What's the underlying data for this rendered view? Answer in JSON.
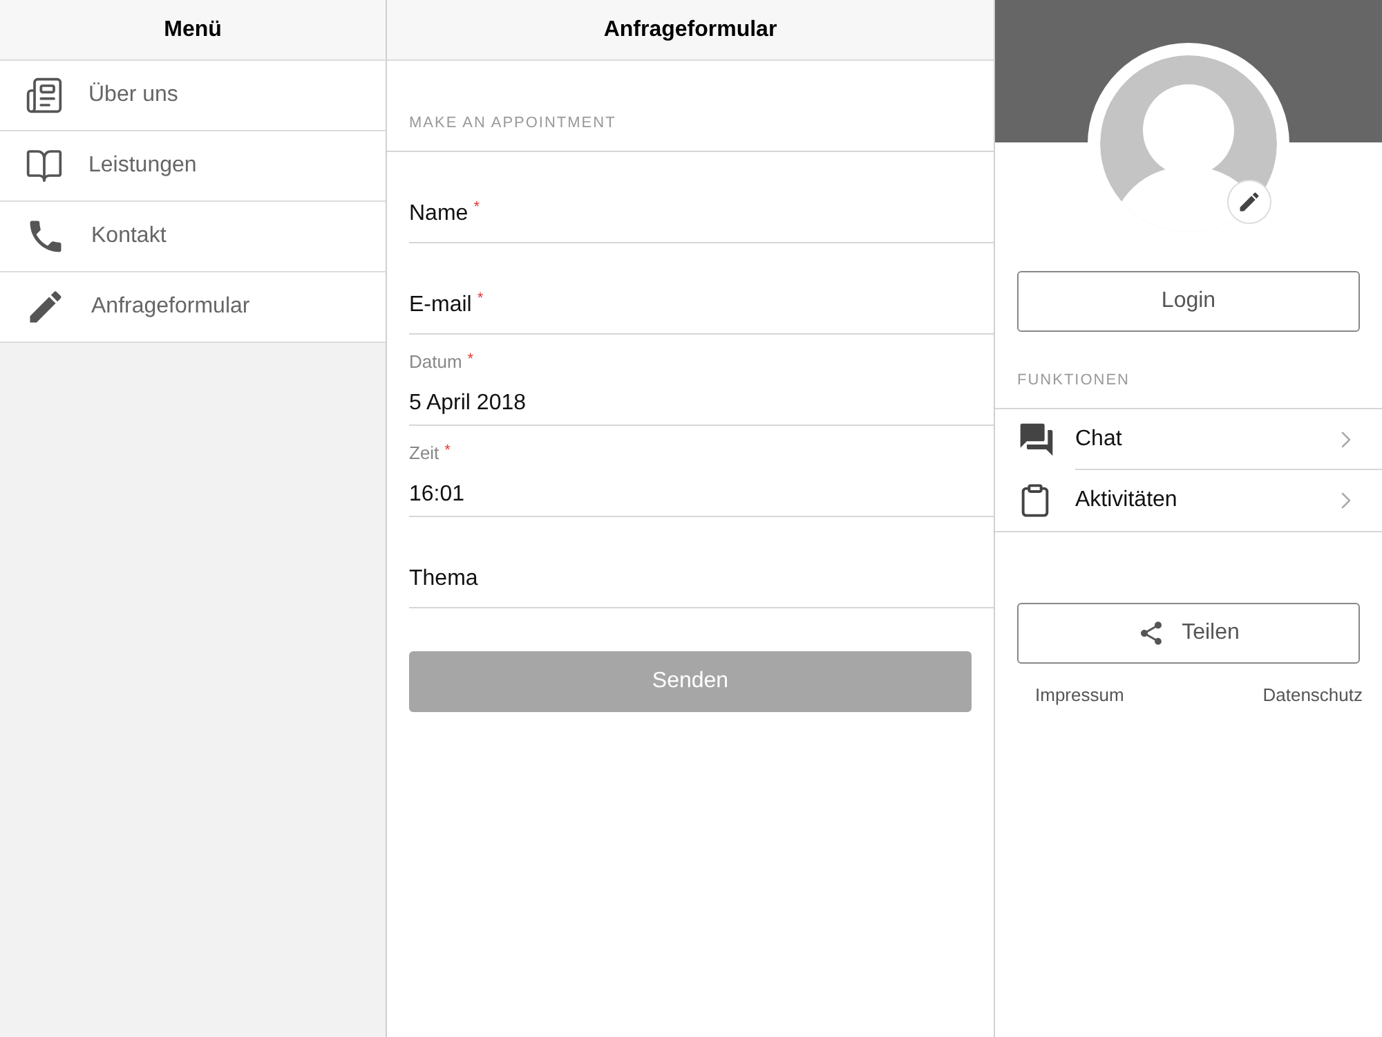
{
  "menu": {
    "title": "Menü",
    "items": [
      {
        "label": "Über uns",
        "kind": "newspaper"
      },
      {
        "label": "Leistungen",
        "kind": "book"
      },
      {
        "label": "Kontakt",
        "kind": "phone"
      },
      {
        "label": "Anfrageformular",
        "kind": "pencil"
      }
    ]
  },
  "form": {
    "title": "Anfrageformular",
    "section": "MAKE AN APPOINTMENT",
    "fields": [
      {
        "kind": "empty",
        "label": "Name",
        "mark": "*"
      },
      {
        "kind": "empty",
        "label": "E-mail",
        "mark": "*"
      },
      {
        "kind": "filled",
        "label": "Datum",
        "mark": "*",
        "value": "5 April 2018"
      },
      {
        "kind": "filled",
        "label": "Zeit",
        "mark": "*",
        "value": "16:01"
      },
      {
        "kind": "empty",
        "label": "Thema"
      }
    ],
    "submit": {
      "label": "Senden",
      "disabled": true
    }
  },
  "profile": {
    "login": "Login",
    "section": "FUNKTIONEN",
    "items": [
      {
        "label": "Chat",
        "kind": "chat"
      },
      {
        "label": "Aktivitäten",
        "kind": "clipboard"
      }
    ],
    "share": "Teilen",
    "links": [
      "Impressum",
      "Datenschutz"
    ]
  }
}
